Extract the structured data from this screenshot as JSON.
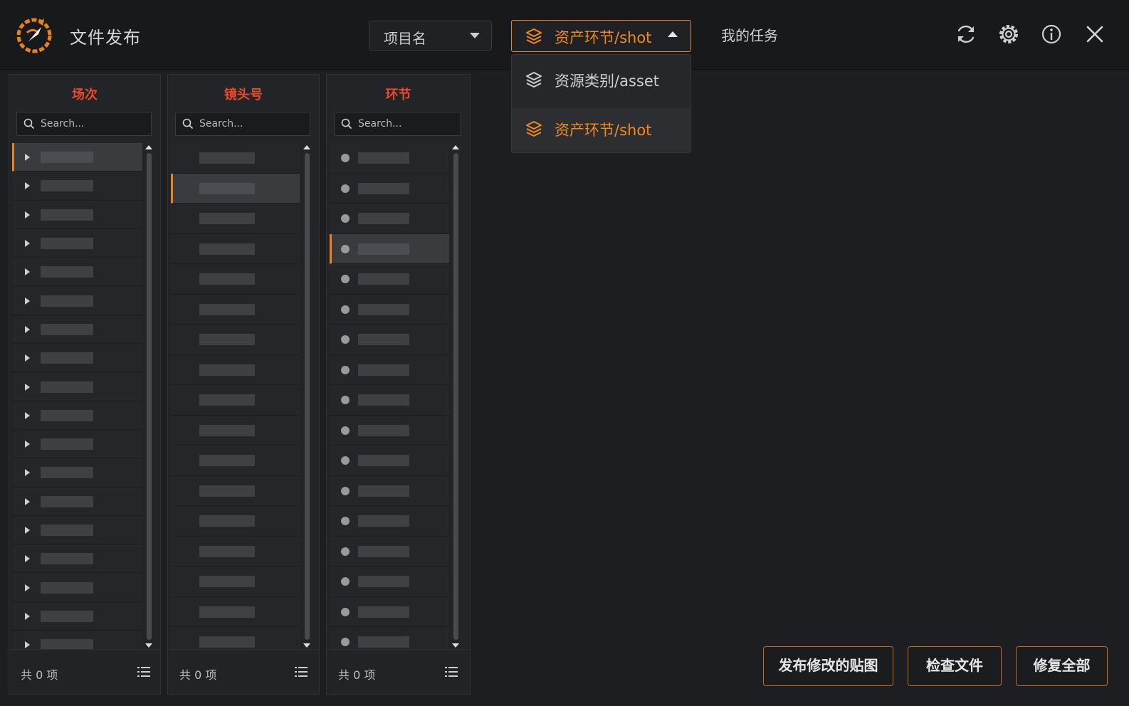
{
  "header": {
    "app_title": "文件发布",
    "project_select_label": "项目名",
    "mode_select_label": "资产环节/shot",
    "my_tasks": "我的任务",
    "icons": [
      "refresh-icon",
      "settings-gear-icon",
      "info-icon",
      "close-icon"
    ]
  },
  "dropdown": {
    "options": [
      {
        "label": "资源类别/asset",
        "selected": false
      },
      {
        "label": "资产环节/shot",
        "selected": true
      }
    ]
  },
  "panels": [
    {
      "title": "场次",
      "placeholder": "Search...",
      "count": "共 0 项",
      "row_count": 18,
      "selected_row": 0,
      "row_marker": "expand-arrow"
    },
    {
      "title": "镜头号",
      "placeholder": "Search...",
      "count": "共 0 项",
      "row_count": 17,
      "selected_row": 1,
      "row_marker": "none"
    },
    {
      "title": "环节",
      "placeholder": "Search...",
      "count": "共 0 项",
      "row_count": 17,
      "selected_row": 3,
      "row_marker": "dot"
    }
  ],
  "actions": {
    "publish_textures": "发布修改的贴图",
    "check_files": "检查文件",
    "fix_all": "修复全部"
  },
  "colors": {
    "accent": "#e8821e",
    "panel_title": "#ea4a2c",
    "background": "#1d1e21"
  }
}
